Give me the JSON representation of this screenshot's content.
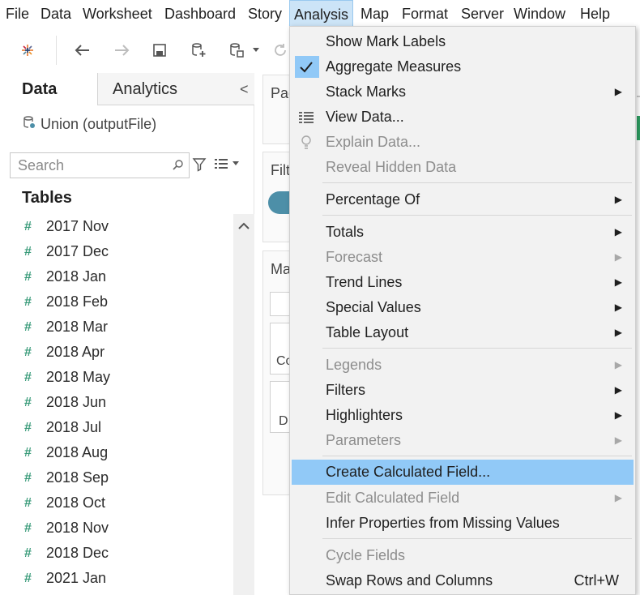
{
  "menubar": {
    "items": [
      {
        "label": "File"
      },
      {
        "label": "Data"
      },
      {
        "label": "Worksheet"
      },
      {
        "label": "Dashboard"
      },
      {
        "label": "Story"
      },
      {
        "label": "Analysis"
      },
      {
        "label": "Map"
      },
      {
        "label": "Format"
      },
      {
        "label": "Server"
      },
      {
        "label": "Window"
      },
      {
        "label": "Help"
      }
    ],
    "active": "Analysis"
  },
  "toolbar": {
    "icons": [
      "tableau-logo-icon",
      "back-arrow-icon",
      "forward-arrow-icon",
      "save-icon",
      "new-datasource-icon",
      "datasource-options-icon",
      "dropdown-caret-icon",
      "refresh-icon"
    ]
  },
  "left_panel": {
    "tabs": [
      {
        "label": "Data",
        "selected": true
      },
      {
        "label": "Analytics",
        "selected": false
      }
    ],
    "collapse_glyph": "<",
    "datasource": "Union (outputFile)",
    "search": {
      "placeholder": "Search",
      "value": ""
    },
    "tables_heading": "Tables",
    "tables": [
      {
        "label": "2017 Nov"
      },
      {
        "label": "2017 Dec"
      },
      {
        "label": "2018 Jan"
      },
      {
        "label": "2018 Feb"
      },
      {
        "label": "2018 Mar"
      },
      {
        "label": "2018 Apr"
      },
      {
        "label": "2018 May"
      },
      {
        "label": "2018 Jun"
      },
      {
        "label": "2018 Jul"
      },
      {
        "label": "2018 Aug"
      },
      {
        "label": "2018 Sep"
      },
      {
        "label": "2018 Oct"
      },
      {
        "label": "2018 Nov"
      },
      {
        "label": "2018 Dec"
      },
      {
        "label": "2021 Jan"
      }
    ],
    "table_glyph": "#"
  },
  "cards": {
    "pages": "Pag",
    "filters": "Filt",
    "marks": "Ma",
    "marks_color": "Co",
    "marks_detail": "D"
  },
  "analysis_menu": {
    "items": [
      {
        "key": "show-mark-labels",
        "label": "Show Mark Labels",
        "enabled": true
      },
      {
        "key": "aggregate-measures",
        "label": "Aggregate Measures",
        "enabled": true,
        "checked": true
      },
      {
        "key": "stack-marks",
        "label": "Stack Marks",
        "enabled": true,
        "submenu": true
      },
      {
        "key": "view-data",
        "label": "View Data...",
        "enabled": true,
        "icon": "table-grid-icon"
      },
      {
        "key": "explain-data",
        "label": "Explain Data...",
        "enabled": false,
        "icon": "lightbulb-icon"
      },
      {
        "key": "reveal-hidden-data",
        "label": "Reveal Hidden Data",
        "enabled": false
      },
      {
        "key": "percentage-of",
        "label": "Percentage Of",
        "enabled": true,
        "submenu": true
      },
      {
        "key": "totals",
        "label": "Totals",
        "enabled": true,
        "submenu": true
      },
      {
        "key": "forecast",
        "label": "Forecast",
        "enabled": false,
        "submenu": true
      },
      {
        "key": "trend-lines",
        "label": "Trend Lines",
        "enabled": true,
        "submenu": true
      },
      {
        "key": "special-values",
        "label": "Special Values",
        "enabled": true,
        "submenu": true
      },
      {
        "key": "table-layout",
        "label": "Table Layout",
        "enabled": true,
        "submenu": true
      },
      {
        "key": "legends",
        "label": "Legends",
        "enabled": false,
        "submenu": true
      },
      {
        "key": "filters",
        "label": "Filters",
        "enabled": true,
        "submenu": true
      },
      {
        "key": "highlighters",
        "label": "Highlighters",
        "enabled": true,
        "submenu": true
      },
      {
        "key": "parameters",
        "label": "Parameters",
        "enabled": false,
        "submenu": true
      },
      {
        "key": "create-calculated-field",
        "label": "Create Calculated Field...",
        "enabled": true,
        "highlighted": true
      },
      {
        "key": "edit-calculated-field",
        "label": "Edit Calculated Field",
        "enabled": false,
        "submenu": true
      },
      {
        "key": "infer-properties",
        "label": "Infer Properties from Missing Values",
        "enabled": true
      },
      {
        "key": "cycle-fields",
        "label": "Cycle Fields",
        "enabled": false
      },
      {
        "key": "swap-rows-columns",
        "label": "Swap Rows and Columns",
        "enabled": true,
        "shortcut": "Ctrl+W"
      }
    ]
  },
  "colors": {
    "menu_highlight": "#91c9f7",
    "menubar_active": "#cce4f7",
    "table_glyph": "#3a9b7a",
    "filter_pill": "#4d8fa8",
    "disabled_text": "#8d8d8d"
  }
}
